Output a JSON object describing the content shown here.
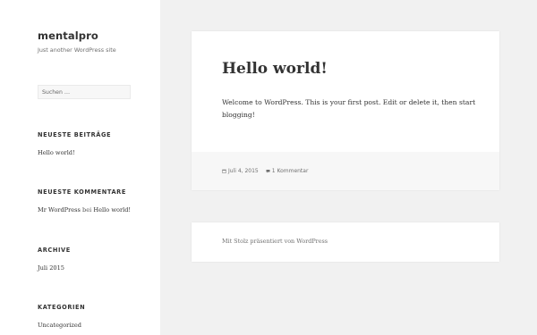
{
  "site": {
    "title": "mentalpro",
    "description": "Just another WordPress site"
  },
  "search": {
    "placeholder": "Suchen …"
  },
  "widgets": {
    "recent_posts": {
      "title": "NEUESTE BEITRÄGE",
      "items": [
        "Hello world!"
      ]
    },
    "recent_comments": {
      "title": "NEUESTE KOMMENTARE",
      "author": "Mr WordPress",
      "connector": "bei",
      "post": "Hello world!"
    },
    "archives": {
      "title": "ARCHIVE",
      "items": [
        "Juli 2015"
      ]
    },
    "categories": {
      "title": "KATEGORIEN",
      "items": [
        "Uncategorized"
      ]
    }
  },
  "post": {
    "title": "Hello world!",
    "content": "Welcome to WordPress. This is your first post. Edit or delete it, then start blogging!",
    "date": "Juli 4, 2015",
    "comments": "1 Kommentar"
  },
  "footer": {
    "text": "Mit Stolz präsentiert von WordPress"
  },
  "colors": {
    "background": "#f1f1f1",
    "card": "#ffffff",
    "text": "#333333",
    "muted": "#707070"
  },
  "icons": {
    "date": "calendar-icon",
    "comments": "comment-icon"
  }
}
